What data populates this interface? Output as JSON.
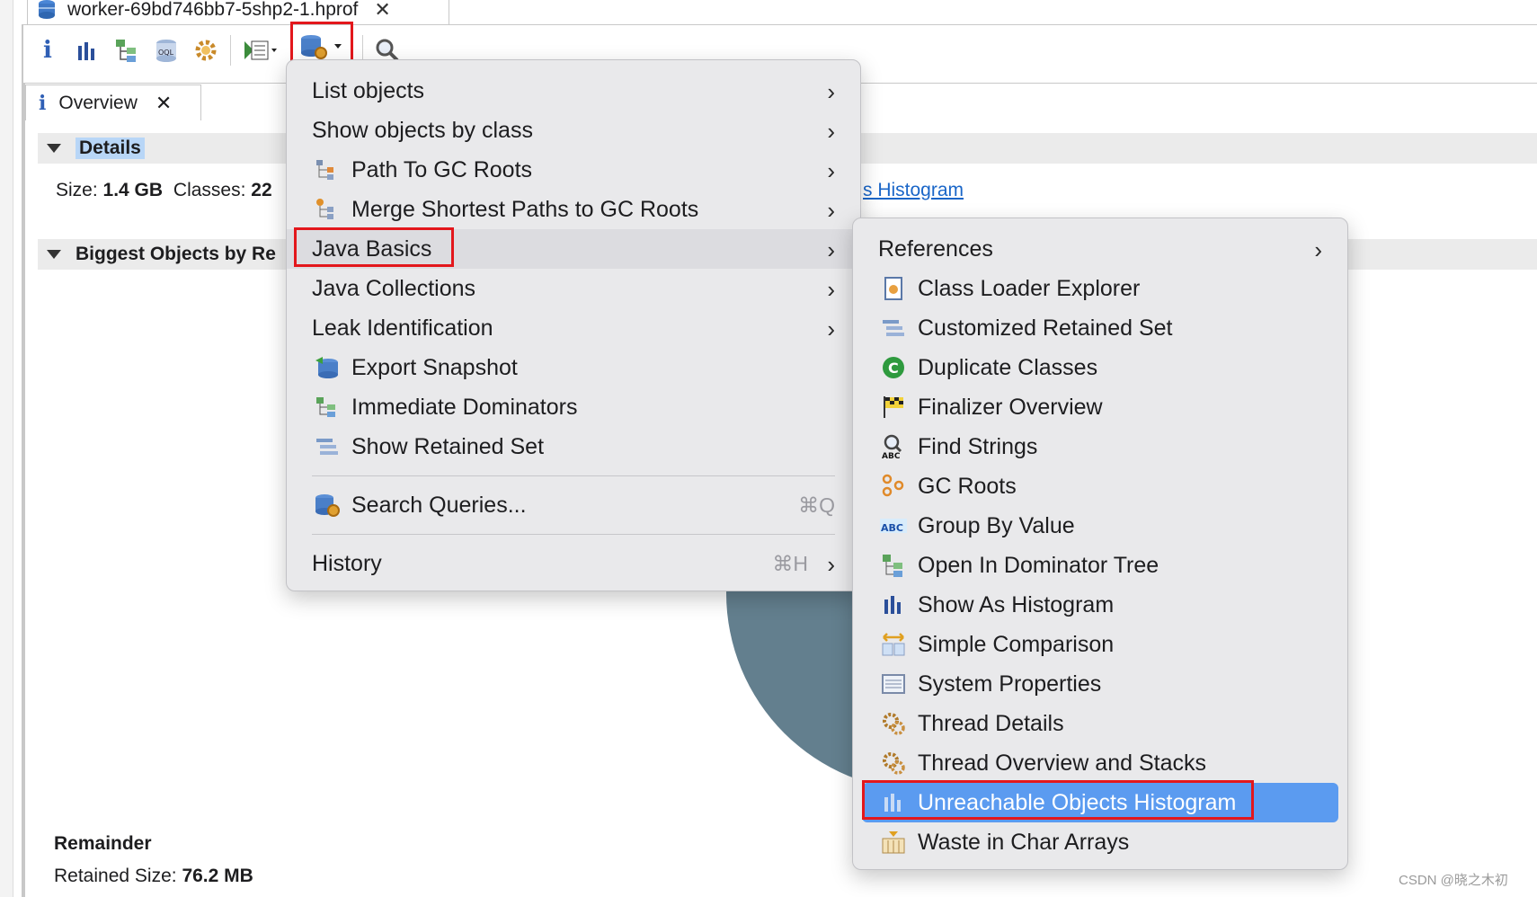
{
  "editor_tab": {
    "title": "worker-69bd746bb7-5shp2-1.hprof"
  },
  "overview_tab": {
    "label": "Overview"
  },
  "details": {
    "title": "Details",
    "size_label": "Size:",
    "size_value": "1.4 GB",
    "classes_label": "Classes:",
    "classes_value": "22",
    "link_fragment": "s Histogram"
  },
  "biggest_objects": {
    "title": "Biggest Objects by Re"
  },
  "remainder": {
    "title": "Remainder",
    "retained_label": "Retained Size:",
    "retained_value": "76.2 MB"
  },
  "main_menu": {
    "items": [
      {
        "label": "List objects",
        "submenu": true
      },
      {
        "label": "Show objects by class",
        "submenu": true
      },
      {
        "label": "Path To GC Roots",
        "submenu": true,
        "icon": "path-to-gc-roots-icon"
      },
      {
        "label": "Merge Shortest Paths to GC Roots",
        "submenu": true,
        "icon": "merge-paths-icon"
      },
      {
        "label": "Java Basics",
        "submenu": true
      },
      {
        "label": "Java Collections",
        "submenu": true
      },
      {
        "label": "Leak Identification",
        "submenu": true
      },
      {
        "label": "Export Snapshot",
        "icon": "export-snapshot-icon"
      },
      {
        "label": "Immediate Dominators",
        "icon": "immediate-dominators-icon"
      },
      {
        "label": "Show Retained Set",
        "icon": "retained-set-icon"
      }
    ],
    "search": {
      "label": "Search Queries...",
      "shortcut": "⌘Q"
    },
    "history": {
      "label": "History",
      "shortcut": "⌘H"
    }
  },
  "sub_menu": {
    "items": [
      {
        "label": "References",
        "submenu": true
      },
      {
        "label": "Class Loader Explorer",
        "icon": "class-loader-icon"
      },
      {
        "label": "Customized Retained Set",
        "icon": "customized-retained-set-icon"
      },
      {
        "label": "Duplicate Classes",
        "icon": "duplicate-classes-icon"
      },
      {
        "label": "Finalizer Overview",
        "icon": "finalizer-icon"
      },
      {
        "label": "Find Strings",
        "icon": "find-strings-icon"
      },
      {
        "label": "GC Roots",
        "icon": "gc-roots-icon"
      },
      {
        "label": "Group By Value",
        "icon": "group-by-value-icon"
      },
      {
        "label": "Open In Dominator Tree",
        "icon": "dominator-tree-icon"
      },
      {
        "label": "Show As Histogram",
        "icon": "histogram-icon"
      },
      {
        "label": "Simple Comparison",
        "icon": "simple-comparison-icon"
      },
      {
        "label": "System Properties",
        "icon": "system-properties-icon"
      },
      {
        "label": "Thread Details",
        "icon": "thread-details-icon"
      },
      {
        "label": "Thread Overview and Stacks",
        "icon": "thread-overview-icon"
      },
      {
        "label": "Unreachable Objects Histogram",
        "icon": "unreachable-histogram-icon"
      },
      {
        "label": "Waste in Char Arrays",
        "icon": "waste-char-arrays-icon"
      }
    ]
  },
  "watermark": "CSDN @晓之木初"
}
